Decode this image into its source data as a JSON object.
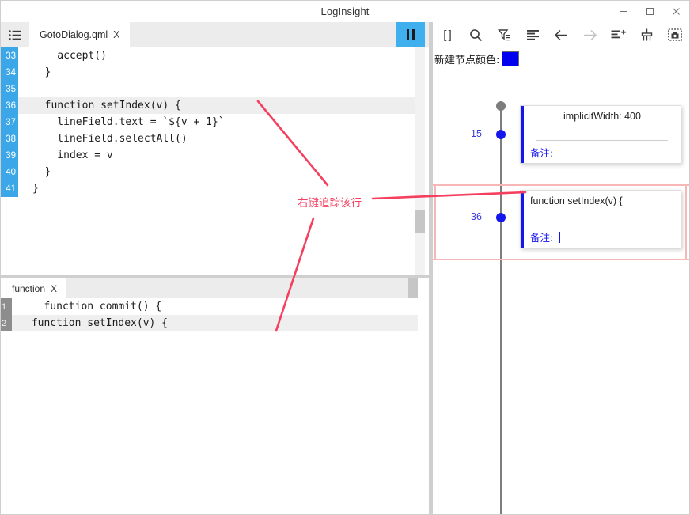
{
  "window": {
    "title": "LogInsight",
    "controls": [
      {
        "name": "minimize-button",
        "glyph": "minimize"
      },
      {
        "name": "maximize-button",
        "glyph": "maximize"
      },
      {
        "name": "close-button",
        "glyph": "close"
      }
    ]
  },
  "editor": {
    "menu_icon": "list-menu-icon",
    "tab": {
      "label": "GotoDialog.qml",
      "close": "X"
    },
    "pause_button": {
      "name": "pause-button",
      "icon": "pause-icon",
      "color": "#40afee"
    },
    "current_line": 36,
    "lines": [
      {
        "number": "33",
        "text": "    accept()",
        "highlight": false
      },
      {
        "number": "34",
        "text": "  }",
        "highlight": false
      },
      {
        "number": "35",
        "text": "",
        "highlight": false
      },
      {
        "number": "36",
        "text": "  function setIndex(v) {",
        "highlight": true
      },
      {
        "number": "37",
        "text": "    lineField.text = `${v + 1}`",
        "highlight": false
      },
      {
        "number": "38",
        "text": "    lineField.selectAll()",
        "highlight": false
      },
      {
        "number": "39",
        "text": "    index = v",
        "highlight": false
      },
      {
        "number": "40",
        "text": "  }",
        "highlight": false
      },
      {
        "number": "41",
        "text": "}",
        "highlight": false
      }
    ]
  },
  "bottom_panel": {
    "tab": {
      "label": "function",
      "close": "X"
    },
    "results": [
      {
        "number": "1",
        "text": "   function commit() {"
      },
      {
        "number": "2",
        "text": " function setIndex(v) {"
      }
    ]
  },
  "right_panel": {
    "toolbar": [
      {
        "name": "brackets-icon",
        "label": "[ ]",
        "disabled": false
      },
      {
        "name": "search-icon",
        "label": "",
        "disabled": false
      },
      {
        "name": "filter-list-icon",
        "label": "",
        "disabled": false
      },
      {
        "name": "align-left-icon",
        "label": "",
        "disabled": false
      },
      {
        "name": "arrow-left-icon",
        "label": "",
        "disabled": false
      },
      {
        "name": "arrow-right-icon",
        "label": "",
        "disabled": true
      },
      {
        "name": "add-to-list-icon",
        "label": "",
        "disabled": false
      },
      {
        "name": "broom-clean-icon",
        "label": "",
        "disabled": false
      },
      {
        "name": "camera-screenshot-icon",
        "label": "",
        "disabled": false
      }
    ],
    "color_row": {
      "label": "新建节点颜色:",
      "swatch_color": "#0000ee"
    },
    "note_label": "备注:",
    "nodes": [
      {
        "line_number": "15",
        "text": "implicitWidth: 400",
        "text_align": "center",
        "accent_color": "#1515ee",
        "note_value": "",
        "selected": false,
        "has_caret": false
      },
      {
        "line_number": "36",
        "text": "function setIndex(v) {",
        "text_align": "left",
        "accent_color": "#1515ee",
        "note_value": "",
        "selected": true,
        "has_caret": true
      }
    ]
  },
  "annotation": {
    "label": "右键追踪该行",
    "color": "#f43f5e"
  }
}
